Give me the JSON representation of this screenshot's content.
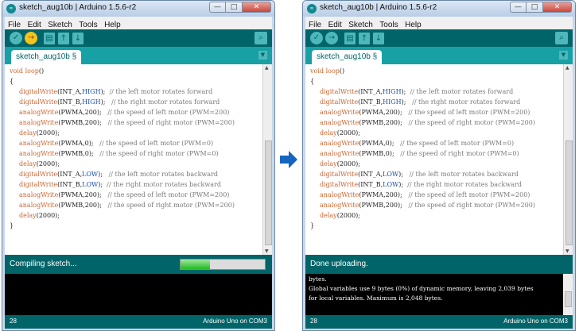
{
  "window_title": "sketch_aug10b | Arduino 1.5.6-r2",
  "app_icon_text": "∞",
  "window_controls": {
    "minimize": "—",
    "maximize": "□",
    "close": "✕"
  },
  "menu": [
    "File",
    "Edit",
    "Sketch",
    "Tools",
    "Help"
  ],
  "toolbar_icons": [
    "verify-icon",
    "upload-icon",
    "new-icon",
    "open-icon",
    "save-icon",
    "serial-monitor-icon"
  ],
  "tab": {
    "label": "sketch_aug10b §",
    "menu_glyph": "▼"
  },
  "code_lines": [
    {
      "indent": 0,
      "segments": [
        {
          "t": "void ",
          "c": "kw"
        },
        {
          "t": "loop",
          "c": "kw"
        },
        {
          "t": "()",
          "c": ""
        }
      ]
    },
    {
      "indent": 0,
      "segments": [
        {
          "t": "{",
          "c": ""
        }
      ]
    },
    {
      "indent": 1,
      "segments": [
        {
          "t": "digitalWrite",
          "c": "kw"
        },
        {
          "t": "(INT_A,",
          "c": ""
        },
        {
          "t": "HIGH",
          "c": "con"
        },
        {
          "t": ");  ",
          "c": ""
        },
        {
          "t": "// the left motor rotates forward",
          "c": "cm"
        }
      ]
    },
    {
      "indent": 1,
      "segments": [
        {
          "t": "digitalWrite",
          "c": "kw"
        },
        {
          "t": "(INT_B,",
          "c": ""
        },
        {
          "t": "HIGH",
          "c": "con"
        },
        {
          "t": ");   ",
          "c": ""
        },
        {
          "t": "// the right motor rotates forward",
          "c": "cm"
        }
      ]
    },
    {
      "indent": 1,
      "segments": [
        {
          "t": "analogWrite",
          "c": "kw"
        },
        {
          "t": "(PWMA,200);   ",
          "c": ""
        },
        {
          "t": "// the speed of left motor (PWM=200)",
          "c": "cm"
        }
      ]
    },
    {
      "indent": 1,
      "segments": [
        {
          "t": "analogWrite",
          "c": "kw"
        },
        {
          "t": "(PWMB,200);   ",
          "c": ""
        },
        {
          "t": "// the speed of right motor (PWM=200)",
          "c": "cm"
        }
      ]
    },
    {
      "indent": 1,
      "segments": [
        {
          "t": "delay",
          "c": "kw"
        },
        {
          "t": "(2000);",
          "c": ""
        }
      ]
    },
    {
      "indent": 1,
      "segments": [
        {
          "t": "analogWrite",
          "c": "kw"
        },
        {
          "t": "(PWMA,0);   ",
          "c": ""
        },
        {
          "t": "// the speed of left motor (PWM=0)",
          "c": "cm"
        }
      ]
    },
    {
      "indent": 1,
      "segments": [
        {
          "t": "analogWrite",
          "c": "kw"
        },
        {
          "t": "(PWMB,0);   ",
          "c": ""
        },
        {
          "t": "// the speed of right motor (PWM=0)",
          "c": "cm"
        }
      ]
    },
    {
      "indent": 1,
      "segments": [
        {
          "t": "delay",
          "c": "kw"
        },
        {
          "t": "(2000);",
          "c": ""
        }
      ]
    },
    {
      "indent": 1,
      "segments": [
        {
          "t": "digitalWrite",
          "c": "kw"
        },
        {
          "t": "(INT_A,",
          "c": ""
        },
        {
          "t": "LOW",
          "c": "con"
        },
        {
          "t": ");   ",
          "c": ""
        },
        {
          "t": "// the left motor rotates backward",
          "c": "cm"
        }
      ]
    },
    {
      "indent": 1,
      "segments": [
        {
          "t": "digitalWrite",
          "c": "kw"
        },
        {
          "t": "(INT_B,",
          "c": ""
        },
        {
          "t": "LOW",
          "c": "con"
        },
        {
          "t": ");  ",
          "c": ""
        },
        {
          "t": "// the right motor rotates backward",
          "c": "cm"
        }
      ]
    },
    {
      "indent": 1,
      "segments": [
        {
          "t": "analogWrite",
          "c": "kw"
        },
        {
          "t": "(PWMA,200);   ",
          "c": ""
        },
        {
          "t": "// the speed of left motor (PWM=200)",
          "c": "cm"
        }
      ]
    },
    {
      "indent": 1,
      "segments": [
        {
          "t": "analogWrite",
          "c": "kw"
        },
        {
          "t": "(PWMB,200);   ",
          "c": ""
        },
        {
          "t": "// the speed of right motor (PWM=200)",
          "c": "cm"
        }
      ]
    },
    {
      "indent": 1,
      "segments": [
        {
          "t": "delay",
          "c": "kw"
        },
        {
          "t": "(2000);",
          "c": ""
        }
      ]
    },
    {
      "indent": 0,
      "segments": [
        {
          "t": "}",
          "c": ""
        }
      ]
    }
  ],
  "left": {
    "status": "Compiling sketch...",
    "progress": 0.35,
    "console_lines": [],
    "line_number": "28",
    "board": "Arduino Uno on COM3"
  },
  "right": {
    "status": "Done uploading.",
    "console_lines": [
      "bytes.",
      "Global variables use 9 bytes (0%) of dynamic memory, leaving 2,039 bytes",
      "for local variables. Maximum is 2,048 bytes."
    ],
    "line_number": "28",
    "board": "Arduino Uno on COM3"
  },
  "colors": {
    "teal_dark": "#006468",
    "teal_tab": "#17a1a5",
    "button": "#4db7bb",
    "upload_active": "#f8c21d",
    "arrow": "#1565c0"
  }
}
